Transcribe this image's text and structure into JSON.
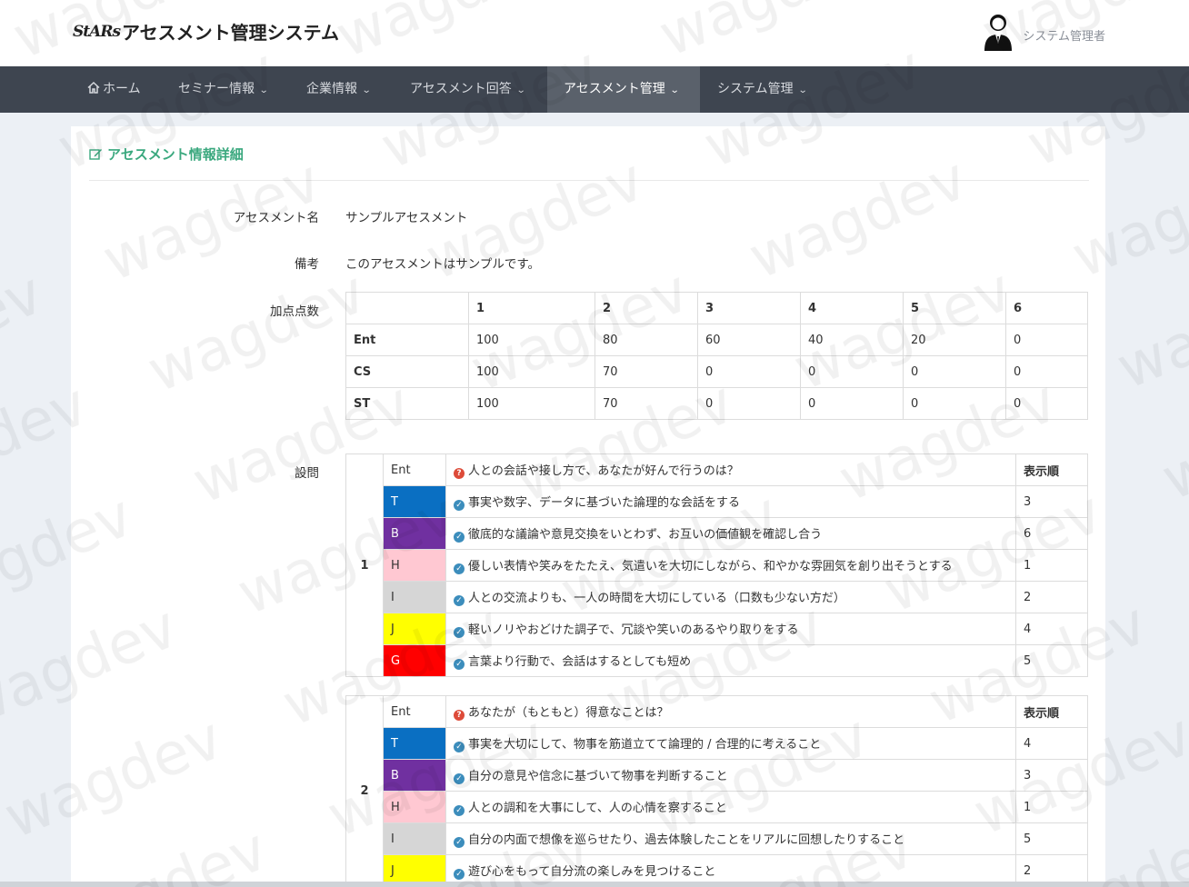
{
  "header": {
    "logo_mark": "StARs",
    "app_title": "アセスメント管理システム",
    "user_name": "システム管理者"
  },
  "nav": {
    "home": "ホーム",
    "items": [
      "セミナー情報",
      "企業情報",
      "アセスメント回答",
      "アセスメント管理",
      "システム管理"
    ],
    "active_index": 3
  },
  "page": {
    "title": "アセスメント情報詳細",
    "fields": {
      "name_label": "アセスメント名",
      "name_value": "サンプルアセスメント",
      "note_label": "備考",
      "note_value": "このアセスメントはサンプルです。",
      "score_label": "加点点数",
      "questions_label": "設問"
    }
  },
  "scores": {
    "headers": [
      "",
      "1",
      "2",
      "3",
      "4",
      "5",
      "6"
    ],
    "rows": [
      [
        "Ent",
        "100",
        "80",
        "60",
        "40",
        "20",
        "0"
      ],
      [
        "CS",
        "100",
        "70",
        "0",
        "0",
        "0",
        "0"
      ],
      [
        "ST",
        "100",
        "70",
        "0",
        "0",
        "0",
        "0"
      ]
    ]
  },
  "questions": [
    {
      "number": "1",
      "category": "Ent",
      "text": "人との会話や接し方で、あなたが好んで行うのは？",
      "order_header": "表示順",
      "choices": [
        {
          "type": "T",
          "color": "#0a6fc2",
          "text": "事実や数字、データに基づいた論理的な会話をする",
          "order": "3"
        },
        {
          "type": "B",
          "color": "#7030a0",
          "text": "徹底的な議論や意見交換をいとわず、お互いの価値観を確認し合う",
          "order": "6"
        },
        {
          "type": "H",
          "color": "#ffc8d2",
          "text": "優しい表情や笑みをたたえ、気遣いを大切にしながら、和やかな雰囲気を創り出そうとする",
          "order": "1"
        },
        {
          "type": "I",
          "color": "#d6d6d6",
          "text": "人との交流よりも、一人の時間を大切にしている（口数も少ない方だ）",
          "order": "2"
        },
        {
          "type": "J",
          "color": "#ffff00",
          "text": "軽いノリやおどけた調子で、冗談や笑いのあるやり取りをする",
          "order": "4"
        },
        {
          "type": "G",
          "color": "#ff0000",
          "text": "言葉より行動で、会話はするとしても短め",
          "order": "5"
        }
      ]
    },
    {
      "number": "2",
      "category": "Ent",
      "text": "あなたが（もともと）得意なことは？",
      "order_header": "表示順",
      "choices": [
        {
          "type": "T",
          "color": "#0a6fc2",
          "text": "事実を大切にして、物事を筋道立てて論理的 / 合理的に考えること",
          "order": "4"
        },
        {
          "type": "B",
          "color": "#7030a0",
          "text": "自分の意見や信念に基づいて物事を判断すること",
          "order": "3"
        },
        {
          "type": "H",
          "color": "#ffc8d2",
          "text": "人との調和を大事にして、人の心情を察すること",
          "order": "1"
        },
        {
          "type": "I",
          "color": "#d6d6d6",
          "text": "自分の内面で想像を巡らせたり、過去体験したことをリアルに回想したりすること",
          "order": "5"
        },
        {
          "type": "J",
          "color": "#ffff00",
          "text": "遊び心をもって自分流の楽しみを見つけること",
          "order": "2"
        }
      ]
    }
  ],
  "watermark_text": "wagdev"
}
